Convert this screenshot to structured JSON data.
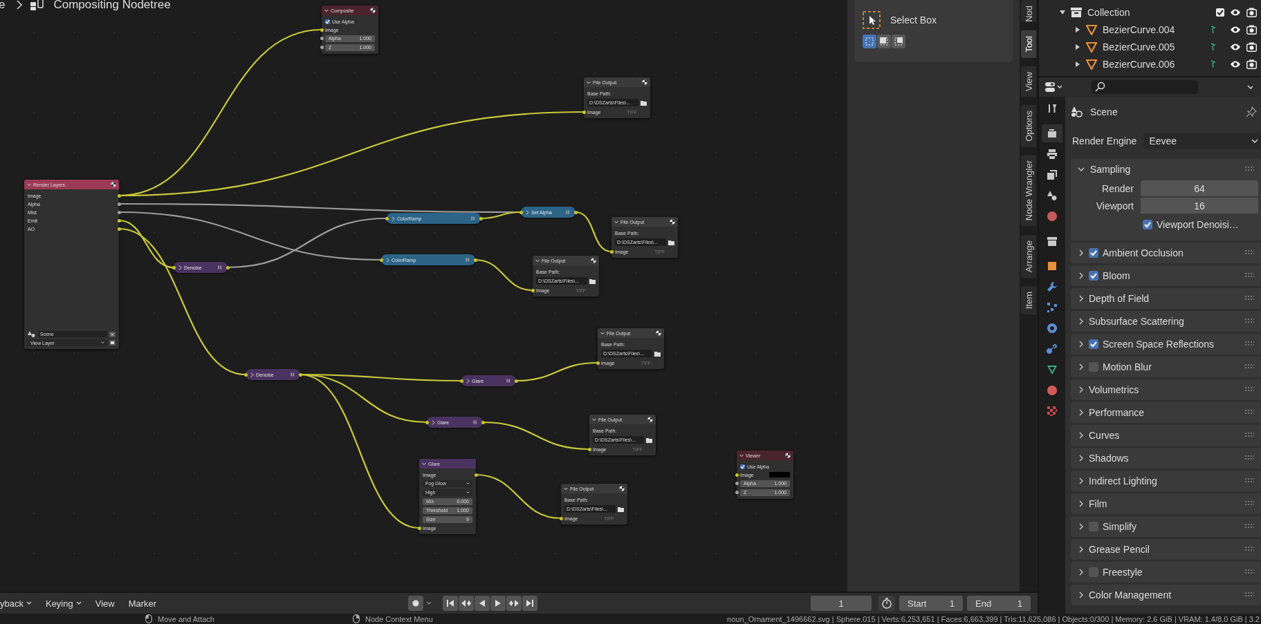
{
  "editor_path": {
    "prefix": "e",
    "title": "Compositing Nodetree"
  },
  "nodes": [
    {
      "kind": "expanded",
      "title": "Composite",
      "color": "#4b2430",
      "icon": true,
      "rows": [
        {
          "kind": "checkbox",
          "label": "Use Alpha",
          "checked": true
        },
        {
          "kind": "in",
          "label": "Image",
          "socket": {
            "color": "#c7c729"
          }
        },
        {
          "kind": "value",
          "label": "Alpha",
          "value": "1.000",
          "socket": {
            "color": "#a1a1a1"
          }
        },
        {
          "kind": "value",
          "label": "Z",
          "value": "1.000",
          "socket": {
            "color": "#a1a1a1"
          }
        }
      ]
    },
    {
      "kind": "expanded",
      "title": "File Output",
      "color": "#3a3a3a",
      "icon": true,
      "rows": [
        {
          "kind": "path_label",
          "label": "Base Path:"
        },
        {
          "kind": "path",
          "value": "D:\\DSZarts\\Files\\..."
        },
        {
          "kind": "file_in",
          "label": "Image",
          "format": "TIFF",
          "socket": {
            "color": "#c7c729"
          }
        }
      ]
    },
    {
      "kind": "expanded",
      "title": "Render Layers",
      "color": "#9c3a55",
      "icon": true,
      "rows": [
        {
          "kind": "out",
          "label": "Image",
          "socket": {
            "color": "#c7c729"
          }
        },
        {
          "kind": "out",
          "label": "Alpha",
          "socket": {
            "color": "#a1a1a1"
          }
        },
        {
          "kind": "out",
          "label": "Mist",
          "socket": {
            "color": "#a1a1a1"
          }
        },
        {
          "kind": "out",
          "label": "Emit",
          "socket": {
            "color": "#c7c729"
          }
        },
        {
          "kind": "out",
          "label": "AO",
          "socket": {
            "color": "#c7c729"
          }
        },
        {
          "kind": "scene_select",
          "value": "Scene"
        },
        {
          "kind": "layer_select",
          "value": "View Layer"
        }
      ]
    },
    {
      "kind": "collapsed",
      "title": "ColorRamp",
      "color": "#2c6387"
    },
    {
      "kind": "collapsed",
      "title": "Set Alpha",
      "color": "#2c6387"
    },
    {
      "kind": "expanded",
      "title": "File Output",
      "color": "#3a3a3a",
      "icon": true,
      "rows": [
        {
          "kind": "path_label",
          "label": "Base Path:"
        },
        {
          "kind": "path",
          "value": "D:\\DSZarts\\Files\\..."
        },
        {
          "kind": "file_in",
          "label": "Image",
          "format": "TIFF",
          "socket": {
            "color": "#c7c729"
          }
        }
      ]
    },
    {
      "kind": "collapsed",
      "title": "Denoise",
      "color": "#4a3360"
    },
    {
      "kind": "collapsed",
      "title": "ColorRamp",
      "color": "#2c6387"
    },
    {
      "kind": "expanded",
      "title": "File Output",
      "color": "#3a3a3a",
      "icon": true,
      "rows": [
        {
          "kind": "path_label",
          "label": "Base Path:"
        },
        {
          "kind": "path",
          "value": "D:\\DSZarts\\Files\\..."
        },
        {
          "kind": "file_in",
          "label": "Image",
          "format": "TIFF",
          "socket": {
            "color": "#c7c729"
          }
        }
      ]
    },
    {
      "kind": "expanded",
      "title": "File Output",
      "color": "#3a3a3a",
      "icon": true,
      "rows": [
        {
          "kind": "path_label",
          "label": "Base Path:"
        },
        {
          "kind": "path",
          "value": "D:\\DSZarts\\Files\\..."
        },
        {
          "kind": "file_in",
          "label": "Image",
          "format": "TIFF",
          "socket": {
            "color": "#c7c729"
          }
        }
      ]
    },
    {
      "kind": "collapsed",
      "title": "Denoise",
      "color": "#4a3360"
    },
    {
      "kind": "collapsed",
      "title": "Glare",
      "color": "#4a3360"
    },
    {
      "kind": "collapsed",
      "title": "Glare",
      "color": "#4a3360"
    },
    {
      "kind": "expanded",
      "title": "File Output",
      "color": "#3a3a3a",
      "icon": true,
      "rows": [
        {
          "kind": "path_label",
          "label": "Base Path:"
        },
        {
          "kind": "path",
          "value": "D:\\DSZarts\\Files\\..."
        },
        {
          "kind": "file_in",
          "label": "Image",
          "format": "TIFF",
          "socket": {
            "color": "#c7c729"
          }
        }
      ]
    },
    {
      "kind": "expanded",
      "title": "Glare",
      "color": "#4a3360",
      "rows": [
        {
          "kind": "out",
          "label": "Image",
          "socket": {
            "color": "#c7c729"
          }
        },
        {
          "kind": "select",
          "value": "Fog Glow"
        },
        {
          "kind": "select",
          "value": "High"
        },
        {
          "kind": "value",
          "label": "Mix",
          "value": "0.000"
        },
        {
          "kind": "value",
          "label": "Threshold",
          "value": "1.000"
        },
        {
          "kind": "value",
          "label": "Size",
          "value": "9"
        },
        {
          "kind": "in",
          "label": "Image",
          "socket": {
            "color": "#c7c729"
          }
        }
      ]
    },
    {
      "kind": "expanded",
      "title": "File Output",
      "color": "#3a3a3a",
      "icon": true,
      "rows": [
        {
          "kind": "path_label",
          "label": "Base Path:"
        },
        {
          "kind": "path",
          "value": "D:\\DSZarts\\Files\\..."
        },
        {
          "kind": "file_in",
          "label": "Image",
          "format": "TIFF",
          "socket": {
            "color": "#c7c729"
          }
        }
      ]
    },
    {
      "kind": "expanded",
      "title": "Viewer",
      "color": "#4b2430",
      "icon": true,
      "rows": [
        {
          "kind": "checkbox",
          "label": "Use Alpha",
          "checked": true
        },
        {
          "kind": "image_in",
          "label": "Image",
          "socket": {
            "color": "#c7c729"
          }
        },
        {
          "kind": "value",
          "label": "Alpha",
          "value": "1.000",
          "socket": {
            "color": "#a1a1a1"
          }
        },
        {
          "kind": "value",
          "label": "Z",
          "value": "1.000",
          "socket": {
            "color": "#a1a1a1"
          }
        }
      ]
    }
  ],
  "tool_panel": {
    "tool": "Select Box",
    "modes": [
      {
        "selected": true
      },
      {
        "selected": false
      },
      {
        "selected": false
      }
    ]
  },
  "sidebar_tabs": [
    {
      "label": "Nod",
      "selected": false
    },
    {
      "label": "Tool",
      "selected": true
    },
    {
      "label": "View",
      "selected": false
    },
    {
      "label": "Options",
      "selected": false
    },
    {
      "label": "Node Wrangler",
      "selected": false
    },
    {
      "label": "Arrange",
      "selected": false
    },
    {
      "label": "Item",
      "selected": false
    }
  ],
  "outliner": {
    "rows": [
      {
        "kind": "collection",
        "label": "Collection",
        "expanded": true,
        "checked": true
      },
      {
        "kind": "object",
        "label": "BezierCurve.004",
        "expanded": false
      },
      {
        "kind": "object",
        "label": "BezierCurve.005",
        "expanded": false
      },
      {
        "kind": "object",
        "label": "BezierCurve.006",
        "expanded": false
      }
    ]
  },
  "properties": {
    "context": "Scene",
    "engine_label": "Render Engine",
    "engine": "Eevee",
    "tabs": [
      {
        "selected": false
      },
      {
        "selected": true
      },
      {
        "selected": false
      },
      {
        "selected": false
      },
      {
        "selected": false
      },
      {
        "selected": false
      },
      {
        "selected": false
      },
      {
        "selected": false
      },
      {
        "selected": false
      },
      {
        "selected": false
      },
      {
        "selected": false
      },
      {
        "selected": false
      },
      {
        "selected": false
      },
      {
        "selected": false
      },
      {
        "selected": false
      }
    ],
    "sampling": {
      "title": "Sampling",
      "expanded": true,
      "fields": [
        {
          "label": "Render",
          "value": "64"
        },
        {
          "label": "Viewport",
          "value": "16"
        }
      ],
      "denoise": {
        "label": "Viewport Denoisi…",
        "checked": true
      }
    },
    "panels": [
      {
        "label": "Ambient Occlusion",
        "kind": "toggle",
        "checked": true,
        "expanded": false
      },
      {
        "label": "Bloom",
        "kind": "toggle",
        "checked": true,
        "expanded": false
      },
      {
        "label": "Depth of Field",
        "kind": "plain",
        "expanded": false
      },
      {
        "label": "Subsurface Scattering",
        "kind": "plain",
        "expanded": false
      },
      {
        "label": "Screen Space Reflections",
        "kind": "toggle",
        "checked": true,
        "expanded": false
      },
      {
        "label": "Motion Blur",
        "kind": "toggle",
        "checked": false,
        "expanded": false
      },
      {
        "label": "Volumetrics",
        "kind": "plain",
        "expanded": false
      },
      {
        "label": "Performance",
        "kind": "plain",
        "expanded": false
      },
      {
        "label": "Curves",
        "kind": "plain",
        "expanded": false
      },
      {
        "label": "Shadows",
        "kind": "plain",
        "expanded": false
      },
      {
        "label": "Indirect Lighting",
        "kind": "plain",
        "expanded": false
      },
      {
        "label": "Film",
        "kind": "plain",
        "expanded": false
      },
      {
        "label": "Simplify",
        "kind": "toggle",
        "checked": false,
        "expanded": false
      },
      {
        "label": "Grease Pencil",
        "kind": "plain",
        "expanded": false
      },
      {
        "label": "Freestyle",
        "kind": "toggle",
        "checked": false,
        "expanded": false
      },
      {
        "label": "Color Management",
        "kind": "plain",
        "expanded": false
      }
    ]
  },
  "timeline": {
    "menus": [
      {
        "label": "yback",
        "dropdown": true
      },
      {
        "label": "Keying",
        "dropdown": true
      },
      {
        "label": "View",
        "dropdown": false
      },
      {
        "label": "Marker",
        "dropdown": false
      }
    ],
    "current_frame": "1",
    "start_label": "Start",
    "start": "1",
    "end_label": "End",
    "end": "1"
  },
  "status_bar": {
    "hints": [
      "Move and Attach",
      "Node Context Menu"
    ],
    "stats": "noun_Ornament_1496662.svg | Sphere.015 | Verts:6,253,651 | Faces:6,663,399 | Tris:11,625,086 | Objects:0/300 | Memory: 2.6 GiB | VRAM: 1.4/8.0 GiB | 3.2"
  }
}
